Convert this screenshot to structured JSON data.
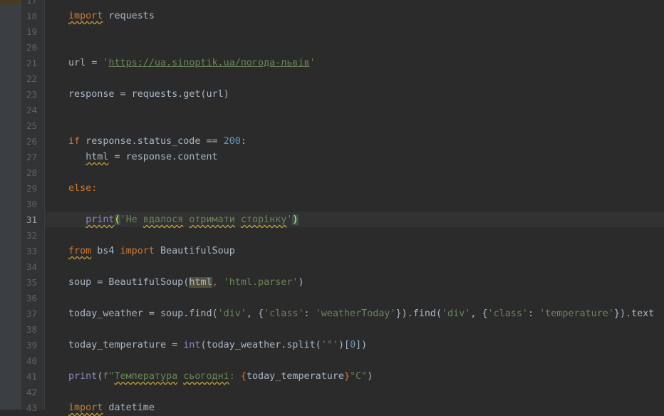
{
  "gutter": {
    "line_numbers": [
      "17",
      "18",
      "19",
      "20",
      "21",
      "22",
      "23",
      "24",
      "25",
      "26",
      "27",
      "28",
      "29",
      "30",
      "31",
      "32",
      "33",
      "34",
      "35",
      "36",
      "37",
      "38",
      "39",
      "40",
      "41",
      "42",
      "43"
    ],
    "current_line": "31"
  },
  "code": {
    "l18": {
      "kw": "import",
      "rest": " requests"
    },
    "l21": {
      "pre": "url = ",
      "q1": "'",
      "url": "https://ua.sinoptik.ua/погода-львів",
      "q2": "'"
    },
    "l23": {
      "text": "response = requests.get(url)"
    },
    "l26": {
      "kw": "if",
      "mid": " response.status_code == ",
      "num": "200",
      "end": ":"
    },
    "l27": {
      "ind": "   ",
      "var": "html",
      "rest": " = response.content"
    },
    "l29": {
      "kw": "else",
      "end": ":"
    },
    "l31": {
      "ind": "   ",
      "fn": "print",
      "open": "(",
      "s1": "'Не ",
      "w1": "вдалося",
      "sp1": " ",
      "w2": "отримати",
      "sp2": " ",
      "w3": "сторінку",
      "s2": "'",
      "close": ")"
    },
    "l33": {
      "kw1": "from",
      "mid": " bs4 ",
      "kw2": "import",
      "rest": " BeautifulSoup"
    },
    "l35": {
      "pre": "soup = BeautifulSoup(",
      "var": "html",
      "comma": ", ",
      "str": "'html.parser'",
      "end": ")"
    },
    "l37": {
      "p1": "today_weather = soup.find(",
      "s1": "'div'",
      "p2": ", {",
      "s2": "'class'",
      "p3": ": ",
      "s3": "'weatherToday'",
      "p4": "}).find(",
      "s4": "'div'",
      "p5": ", {",
      "s5": "'class'",
      "p6": ": ",
      "s6": "'temperature'",
      "p7": "}).text"
    },
    "l39": {
      "p1": "today_temperature = ",
      "fn": "int",
      "p2": "(today_weather.split(",
      "s1": "'°'",
      "p3": ")[",
      "num": "0",
      "p4": "])"
    },
    "l41": {
      "fn": "print",
      "p1": "(",
      "s1": "f\"",
      "w1": "Температура",
      "sp": " ",
      "w2": "сьогодні",
      "s2": ": ",
      "b1": "{",
      "v": "today_temperature",
      "b2": "}",
      "s3": "°C\"",
      "p2": ")"
    },
    "l43": {
      "kw": "import",
      "rest": " datetime"
    }
  }
}
